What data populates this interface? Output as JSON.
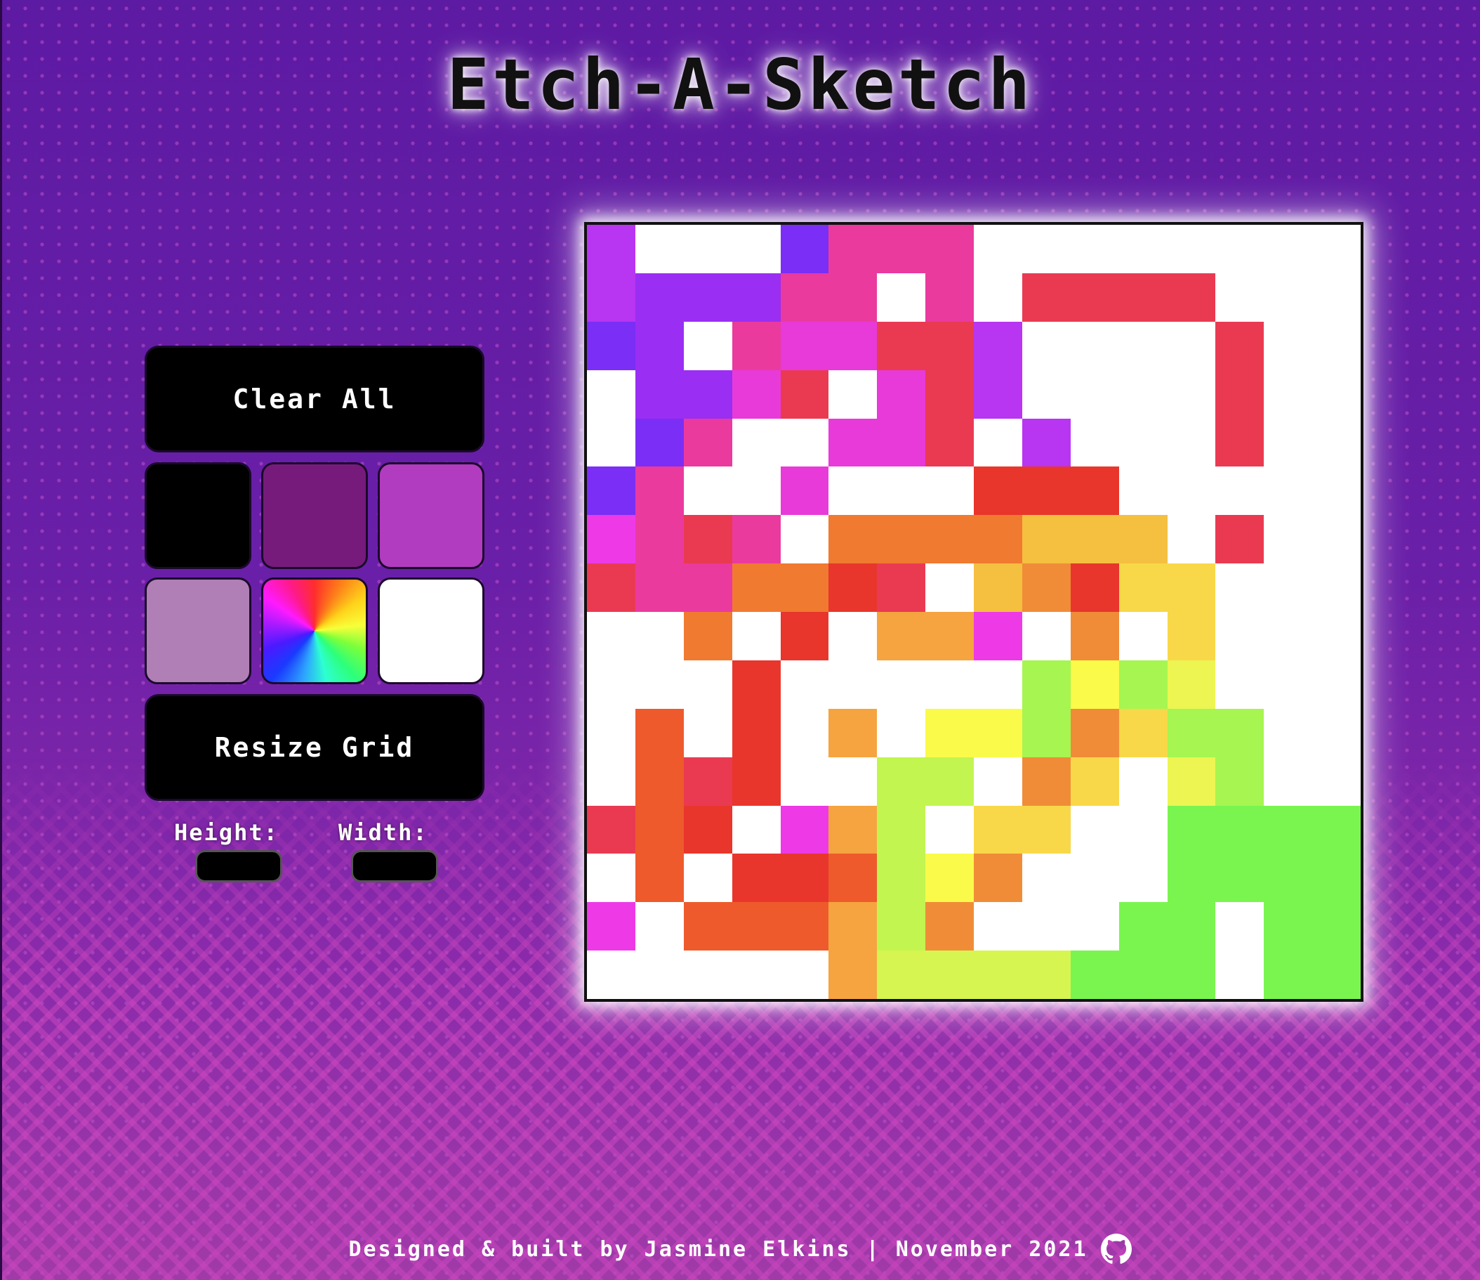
{
  "header": {
    "title": "Etch-A-Sketch"
  },
  "controls": {
    "clear_label": "Clear All",
    "resize_label": "Resize Grid",
    "height_label": "Height:",
    "width_label": "Width:",
    "height_value": "",
    "width_value": ""
  },
  "palette": [
    {
      "name": "black",
      "color": "#000000"
    },
    {
      "name": "plum",
      "color": "#761b7c"
    },
    {
      "name": "orchid",
      "color": "#b23cbf"
    },
    {
      "name": "lilac",
      "color": "#b07fb5"
    },
    {
      "name": "rainbow",
      "color": "rainbow"
    },
    {
      "name": "white",
      "color": "#ffffff"
    }
  ],
  "grid": {
    "rows": 16,
    "cols": 16,
    "colors": {
      "W": "#ffffff",
      "A": "#b835f2",
      "B": "#7b2ef5",
      "C": "#9a2ef2",
      "D": "#ea3a9e",
      "E": "#e93aa0",
      "F": "#ea3a52",
      "G": "#e83ad8",
      "H": "#ec3a3a",
      "I": "#f07a30",
      "J": "#f5bf40",
      "K": "#f5a440",
      "L": "#f08c38",
      "M": "#ee5a2c",
      "N": "#f8d848",
      "O": "#c2f550",
      "P": "#ecf552",
      "Q": "#fafa4a",
      "R": "#a6f550",
      "S": "#7af550",
      "T": "#d6f550",
      "U": "#e8362c",
      "V": "#ee3ae6"
    },
    "rows_data": [
      "AWWWBDDDWWWWWWWW",
      "ACCCDDWDWFFFFWWW",
      "BCWDGGFFAWWWWFWW",
      "WCCGFWGFAWWWWFWW",
      "WBDWWGGFWAWWWFWW",
      "BDWWGWWWUUUWWWWW",
      "VDFDWIIIIJJJWFWW",
      "FDDIIUFWJLUNNWWW",
      "WWIWUWKKVWLWNWWW",
      "WWWUWWWWWRQRPWWW",
      "WMWUWKWQQRLNRRWW",
      "WMFUWWOOWLNWPRWW",
      "FMUWVKOWNNWWSSSS",
      "WMWUUMOQLWWWSSSS",
      "VWMMMKOLWWWSSWSS",
      "WWWWWKTTTTSSSWSS"
    ]
  },
  "footer": {
    "credit": "Designed & built by Jasmine Elkins | November 2021",
    "icon": "github-icon"
  }
}
